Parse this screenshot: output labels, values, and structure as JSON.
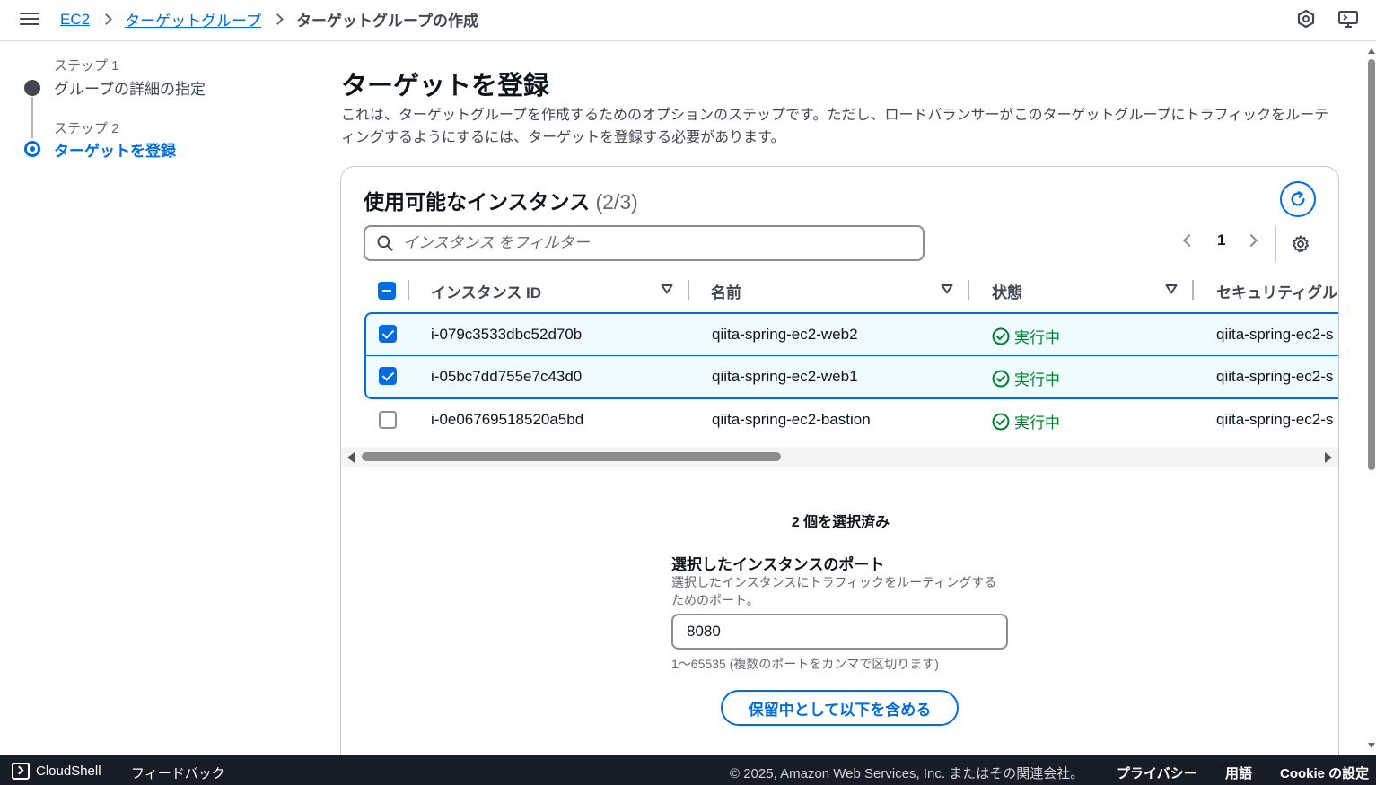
{
  "breadcrumb": {
    "items": [
      "EC2",
      "ターゲットグループ"
    ],
    "current": "ターゲットグループの作成"
  },
  "steps": [
    {
      "number": "ステップ 1",
      "title": "グループの詳細の指定"
    },
    {
      "number": "ステップ 2",
      "title": "ターゲットを登録"
    }
  ],
  "page": {
    "title": "ターゲットを登録",
    "description": "これは、ターゲットグループを作成するためのオプションのステップです。ただし、ロードバランサーがこのターゲットグループにトラフィックをルーティングするようにするには、ターゲットを登録する必要があります。"
  },
  "instances": {
    "title": "使用可能なインスタンス",
    "count": "(2/3)",
    "filter_placeholder": "インスタンス をフィルター",
    "page_number": "1",
    "columns": [
      "インスタンス ID",
      "名前",
      "状態",
      "セキュリティグル"
    ],
    "rows": [
      {
        "id": "i-079c3533dbc52d70b",
        "name": "qiita-spring-ec2-web2",
        "state": "実行中",
        "security_group": "qiita-spring-ec2-s",
        "selected": true
      },
      {
        "id": "i-05bc7dd755e7c43d0",
        "name": "qiita-spring-ec2-web1",
        "state": "実行中",
        "security_group": "qiita-spring-ec2-s",
        "selected": true
      },
      {
        "id": "i-0e06769518520a5bd",
        "name": "qiita-spring-ec2-bastion",
        "state": "実行中",
        "security_group": "qiita-spring-ec2-s",
        "selected": false
      }
    ]
  },
  "selection": {
    "count_text": "2 個を選択済み",
    "port_label": "選択したインスタンスのポート",
    "port_desc": "選択したインスタンスにトラフィックをルーティングするためのポート。",
    "port_value": "8080",
    "port_hint": "1〜65535 (複数のポートをカンマで区切ります)",
    "include_button": "保留中として以下を含める"
  },
  "footer": {
    "cloudshell": "CloudShell",
    "feedback": "フィードバック",
    "copyright": "© 2025, Amazon Web Services, Inc. またはその関連会社。",
    "privacy": "プライバシー",
    "terms": "用語",
    "cookie": "Cookie の設定"
  },
  "colors": {
    "accent": "#006ce0",
    "status_running": "#00802f",
    "footer_bg": "#161d26"
  },
  "icons": [
    "menu-icon",
    "chevron-right-icon",
    "shield-icon",
    "screen-icon",
    "refresh-icon",
    "search-icon",
    "settings-icon",
    "sort-icon",
    "check-circle-icon",
    "terminal-icon"
  ]
}
